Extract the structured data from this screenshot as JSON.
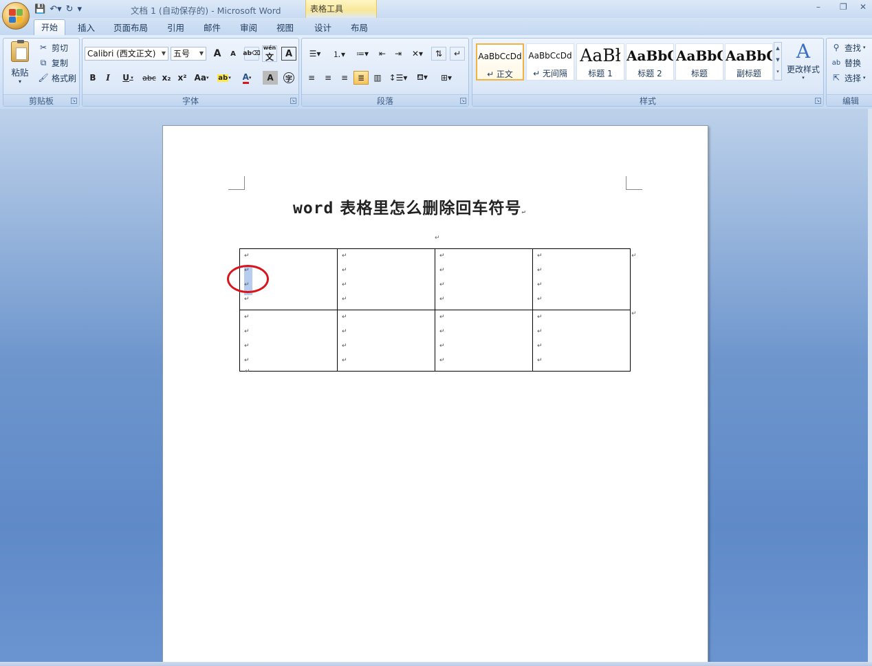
{
  "titlebar": {
    "doc_title": "文档 1 (自动保存的) - Microsoft Word",
    "context_tools": "表格工具",
    "qat_icons": [
      "save-icon",
      "undo-icon",
      "redo-icon",
      "customize-icon"
    ],
    "win_minimize": "–",
    "win_restore": "❐",
    "win_close": "✕"
  },
  "tabs": [
    "开始",
    "插入",
    "页面布局",
    "引用",
    "邮件",
    "审阅",
    "视图"
  ],
  "context_tabs": [
    "设计",
    "布局"
  ],
  "clipboard": {
    "paste": "粘贴",
    "cut": "剪切",
    "copy": "复制",
    "format_painter": "格式刷",
    "label": "剪贴板"
  },
  "font": {
    "family": "Calibri (西文正文)",
    "size": "五号",
    "label": "字体",
    "bold": "B",
    "italic": "I",
    "underline": "U",
    "strike": "abc",
    "subscript": "x₂",
    "superscript": "x²",
    "change_case": "Aa",
    "grow": "A",
    "shrink": "A",
    "phonetic": "wén",
    "phonetic2": "文"
  },
  "paragraph": {
    "label": "段落"
  },
  "styles": {
    "label": "样式",
    "items": [
      {
        "sample": "AaBbCcDd",
        "name": "↵ 正文"
      },
      {
        "sample": "AaBbCcDd",
        "name": "↵ 无间隔"
      },
      {
        "sample": "AaBł",
        "name": "标题 1"
      },
      {
        "sample": "AaBbC",
        "name": "标题 2"
      },
      {
        "sample": "AaBbC",
        "name": "标题"
      },
      {
        "sample": "AaBbC",
        "name": "副标题"
      }
    ],
    "change_styles": "更改样式"
  },
  "editing": {
    "find": "查找",
    "replace": "替换",
    "select": "选择",
    "label": "编辑"
  },
  "document": {
    "heading_latin": "word",
    "heading_cn": " 表格里怎么删除回车符号",
    "para_mark": "↵",
    "table": {
      "rows": 2,
      "cols": 4,
      "marks_per_cell": 4
    }
  },
  "colors": {
    "accent": "#f2b345",
    "highlight_ring": "#d8141c",
    "selection": "#b6cdef"
  }
}
